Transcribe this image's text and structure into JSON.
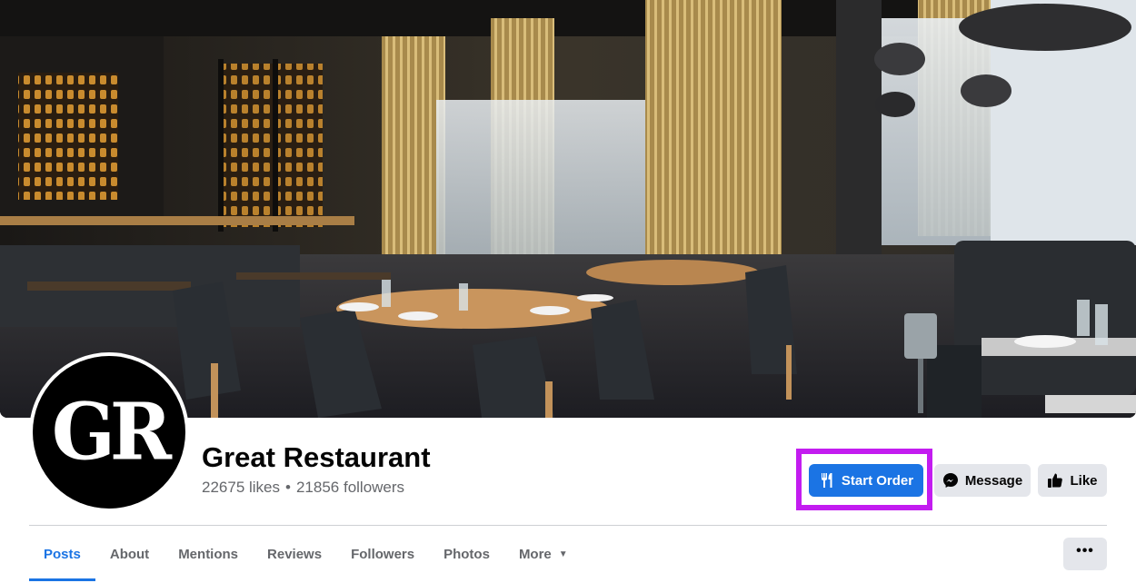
{
  "cover": {
    "description_icon": "restaurant-interior-photo"
  },
  "profile": {
    "avatar_text": "GR",
    "name": "Great Restaurant",
    "likes": "22675 likes",
    "separator": "•",
    "followers": "21856 followers"
  },
  "actions": {
    "start_order": {
      "label": "Start Order",
      "icon": "fork-knife-icon"
    },
    "message": {
      "label": "Message",
      "icon": "messenger-icon"
    },
    "like": {
      "label": "Like",
      "icon": "thumbs-up-icon"
    }
  },
  "tabs": [
    {
      "label": "Posts",
      "active": true
    },
    {
      "label": "About"
    },
    {
      "label": "Mentions"
    },
    {
      "label": "Reviews"
    },
    {
      "label": "Followers"
    },
    {
      "label": "Photos"
    },
    {
      "label": "More"
    }
  ],
  "more_menu": {
    "label": "•••"
  },
  "colors": {
    "accent": "#1b74e4",
    "highlight": "#c31cf0",
    "secondary_button": "#e4e6eb"
  }
}
